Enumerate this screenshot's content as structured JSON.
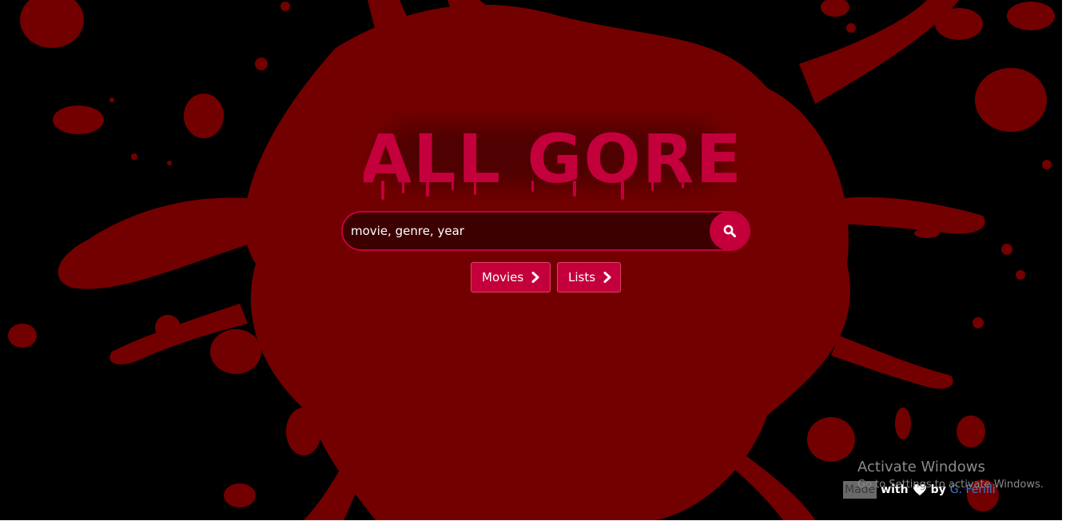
{
  "brand": {
    "logo_text": "ALL GORE",
    "logo_color": "#c4003c"
  },
  "search": {
    "placeholder": "movie, genre, year",
    "button_icon": "search-icon"
  },
  "nav": {
    "movies_label": "Movies",
    "lists_label": "Lists",
    "chevron_icon": "chevron-right-icon"
  },
  "footer": {
    "made": "Made",
    "with": "with",
    "heart_icon": "heart-icon",
    "by": "by",
    "author": "G. Ferilli"
  },
  "watermark": {
    "title": "Activate Windows",
    "subtitle": "Go to Settings to activate Windows."
  },
  "colors": {
    "background": "#000000",
    "blood": "#730000",
    "accent": "#c4003c",
    "search_bg": "#3d0000",
    "link": "#3a7bd5"
  }
}
